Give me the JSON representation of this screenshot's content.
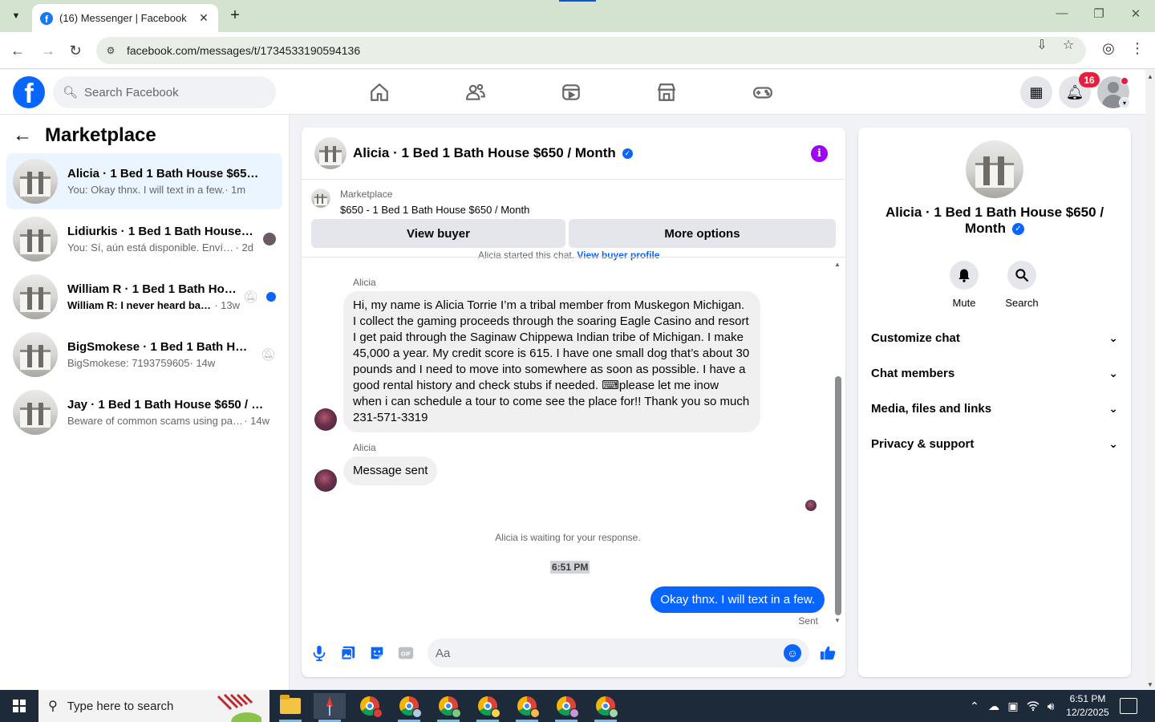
{
  "browser": {
    "tab_title": "(16) Messenger | Facebook",
    "url": "facebook.com/messages/t/1734533190594136",
    "tab_list_icon": "chevron-down-icon",
    "favicon": "f"
  },
  "fb": {
    "logo": "f",
    "search_placeholder": "Search Facebook",
    "notification_count": "16",
    "accent": "#0866ff"
  },
  "sidebar": {
    "title": "Marketplace",
    "conversations": [
      {
        "name": "Alicia · 1 Bed 1 Bath House $650 / ...",
        "preview": "You: Okay thnx. I will text in a few.",
        "time": " · 1m",
        "active": true
      },
      {
        "name": "Lidiurkis · 1 Bed 1 Bath House $6...",
        "preview": "You: Sí, aún está disponible. Envía...",
        "time": " · 2d"
      },
      {
        "name": "William R · 1 Bed 1 Bath Hous...",
        "preview": "William R: I never heard bac...",
        "time": " · 13w",
        "unread": true
      },
      {
        "name": "BigSmokese · 1 Bed 1 Bath Hous...",
        "preview": "BigSmokese: 7193759605",
        "time": " · 14w"
      },
      {
        "name": "Jay · 1 Bed 1 Bath House $650 / M...",
        "preview": "Beware of common scams using pay...",
        "time": " · 14w"
      }
    ]
  },
  "chat": {
    "title": "Alicia · 1 Bed 1 Bath House $650 / Month",
    "listing_label": "Marketplace",
    "listing_desc": "$650 - 1 Bed 1 Bath House $650 / Month",
    "view_buyer": "View buyer",
    "more_options": "More options",
    "started_text": "Alicia started this chat.",
    "view_buyer_profile": "View buyer profile",
    "messages": [
      {
        "sender": "Alicia",
        "text": "Hi, my name is Alicia Torrie I’m a tribal member from Muskegon Michigan. I collect the gaming proceeds through the soaring Eagle Casino and resort I get paid through the Saginaw Chippewa Indian tribe of Michigan. I make 45,000 a year. My credit score is 615. I have one small dog that’s about 30 pounds and I need to move into somewhere as soon as possible. I have a good rental history and check stubs if needed. ⌨please let me inow when i can schedule a tour to come see the place for!! Thank you so much 231-571-3319"
      },
      {
        "sender": "Alicia",
        "text": "Message sent"
      }
    ],
    "waiting": "Alicia is waiting for your response.",
    "timestamp": "6:51 PM",
    "outgoing": "Okay thnx. I will text in a few.",
    "sent_label": "Sent",
    "composer_placeholder": "Aa"
  },
  "info_panel": {
    "name": "Alicia · 1 Bed 1 Bath House $650 / Month",
    "mute": "Mute",
    "search": "Search",
    "sections": [
      "Customize chat",
      "Chat members",
      "Media, files and links",
      "Privacy & support"
    ]
  },
  "taskbar": {
    "search_placeholder": "Type here to search",
    "time": "6:51 PM",
    "date": "12/2/2025"
  }
}
